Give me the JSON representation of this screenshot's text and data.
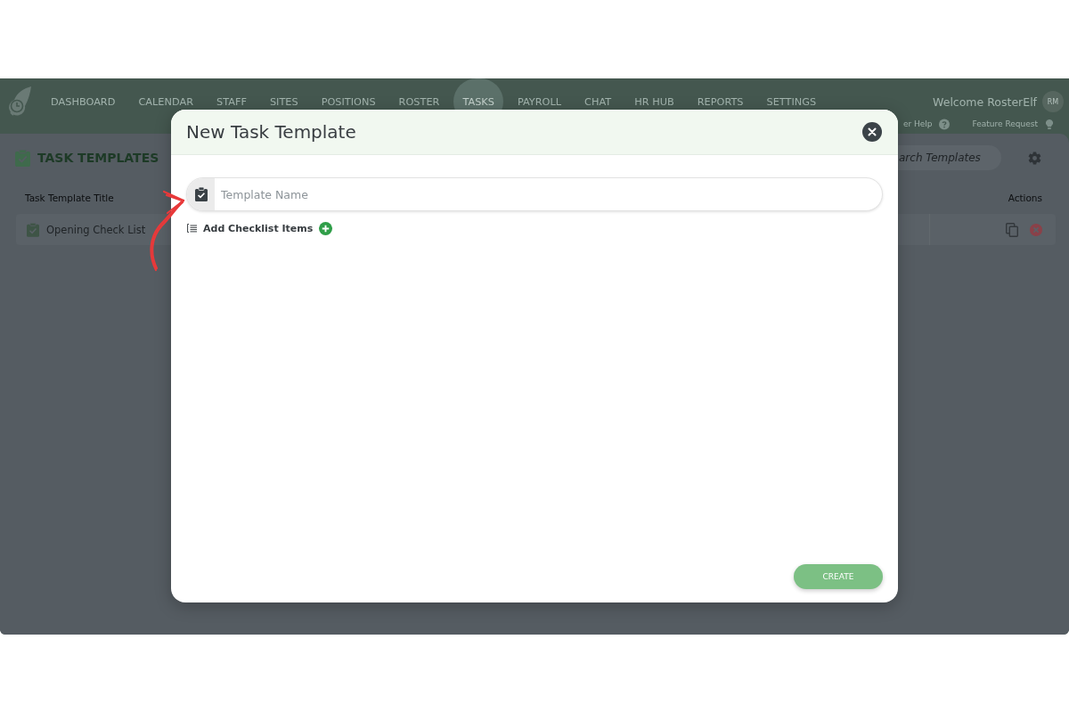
{
  "nav": {
    "items": [
      {
        "label": "DASHBOARD",
        "selected": false
      },
      {
        "label": "CALENDAR",
        "selected": false
      },
      {
        "label": "STAFF",
        "selected": false
      },
      {
        "label": "SITES",
        "selected": false
      },
      {
        "label": "POSITIONS",
        "selected": false
      },
      {
        "label": "ROSTER",
        "selected": false
      },
      {
        "label": "TASKS",
        "selected": true
      },
      {
        "label": "PAYROLL",
        "selected": false
      },
      {
        "label": "CHAT",
        "selected": false
      },
      {
        "label": "HR HUB",
        "selected": false
      },
      {
        "label": "REPORTS",
        "selected": false
      },
      {
        "label": "SETTINGS",
        "selected": false
      }
    ],
    "welcome": "Welcome RosterElf",
    "avatar": "RM",
    "links": [
      {
        "label": "er Help",
        "kind": "help"
      },
      {
        "label": "Feature Request",
        "kind": "idea"
      }
    ]
  },
  "page": {
    "title": "TASK TEMPLATES",
    "search": {
      "placeholder": "arch Templates"
    },
    "table": {
      "columns": [
        "Task Template Title",
        "Actions"
      ],
      "rows": [
        {
          "title": "Opening Check List"
        }
      ]
    }
  },
  "modal": {
    "title": "New Task Template",
    "name_field": {
      "placeholder": "Template Name"
    },
    "add_items_label": "Add Checklist Items",
    "create_button": "CREATE"
  }
}
